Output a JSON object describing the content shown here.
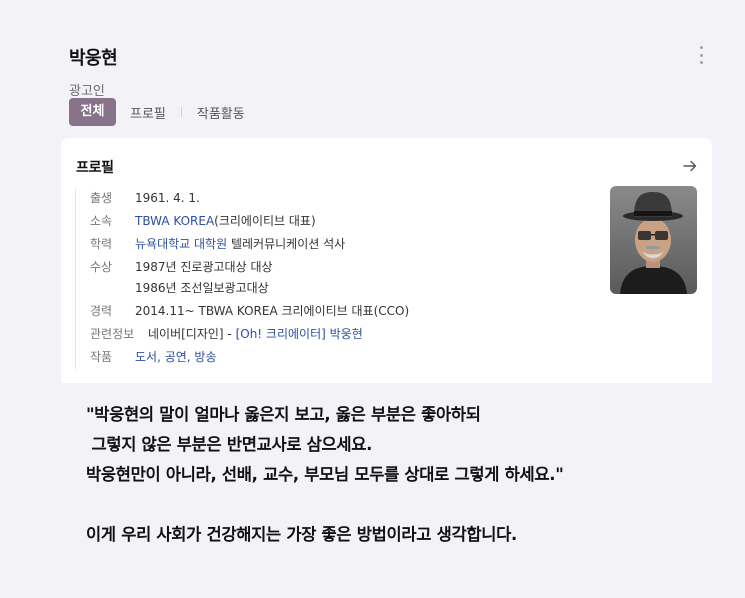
{
  "profile": {
    "name": "박웅현",
    "occupation": "광고인"
  },
  "tabs": [
    {
      "label": "전체",
      "active": true
    },
    {
      "label": "프로필",
      "active": false
    },
    {
      "label": "작품활동",
      "active": false
    }
  ],
  "card": {
    "title": "프로필",
    "rows": {
      "birth": {
        "label": "출생",
        "value": "1961. 4. 1."
      },
      "affiliation": {
        "label": "소속",
        "link": "TBWA KOREA",
        "suffix": "(크리에이티브 대표)"
      },
      "education": {
        "label": "학력",
        "link": "뉴욕대학교 대학원",
        "suffix": " 텔레커뮤니케이션 석사"
      },
      "awards": {
        "label": "수상",
        "values": [
          "1987년 진로광고대상 대상",
          "1986년 조선일보광고대상"
        ]
      },
      "career": {
        "label": "경력",
        "value": "2014.11~ TBWA KOREA 크리에이티브 대표(CCO)"
      },
      "related": {
        "label": "관련정보",
        "prefix": "네이버[디자인] - ",
        "link": "[Oh! 크리에이터] 박웅현"
      },
      "works": {
        "label": "작품",
        "link": "도서, 공연, 방송"
      }
    }
  },
  "quote": {
    "lines": [
      "\"박웅현의 말이 얼마나 옳은지 보고, 옳은 부분은 좋아하되",
      " 그렇지 않은 부분은 반면교사로 삼으세요.",
      "박웅현만이 아니라, 선배, 교수, 부모님 모두를 상대로 그렇게 하세요.\""
    ],
    "closing": "이게 우리 사회가 건강해지는 가장 좋은 방법이라고 생각합니다."
  }
}
